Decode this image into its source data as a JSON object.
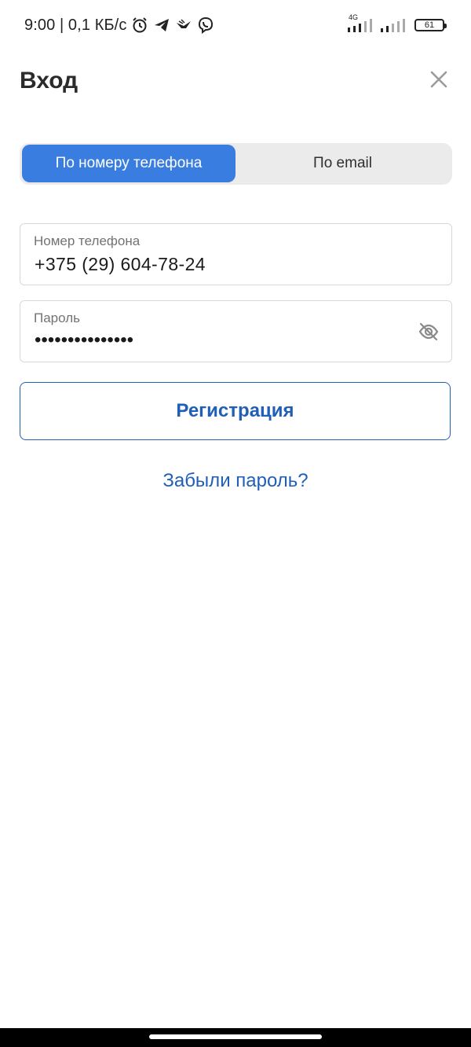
{
  "status_bar": {
    "time_speed": "9:00 | 0,1 КБ/с",
    "network_label": "4G",
    "battery_level": "61",
    "icons": [
      "alarm-icon",
      "telegram-icon",
      "bird-app-icon",
      "viber-icon",
      "signal-4g-icon",
      "signal-icon",
      "battery-icon"
    ]
  },
  "header": {
    "title": "Вход",
    "close_icon": "close-icon"
  },
  "tabs": [
    {
      "label": "По номеру телефона",
      "active": true
    },
    {
      "label": "По email",
      "active": false
    }
  ],
  "phone_field": {
    "label": "Номер телефона",
    "value": "+375 (29) 604-78-24"
  },
  "password_field": {
    "label": "Пароль",
    "value": "•••••••••••••••",
    "toggle_icon": "eye-off-icon"
  },
  "register_button": {
    "label": "Регистрация"
  },
  "forgot_password": {
    "label": "Забыли пароль?"
  },
  "colors": {
    "accent": "#3a7de0",
    "link": "#1f5fb7",
    "tab_bg": "#ebebeb"
  }
}
